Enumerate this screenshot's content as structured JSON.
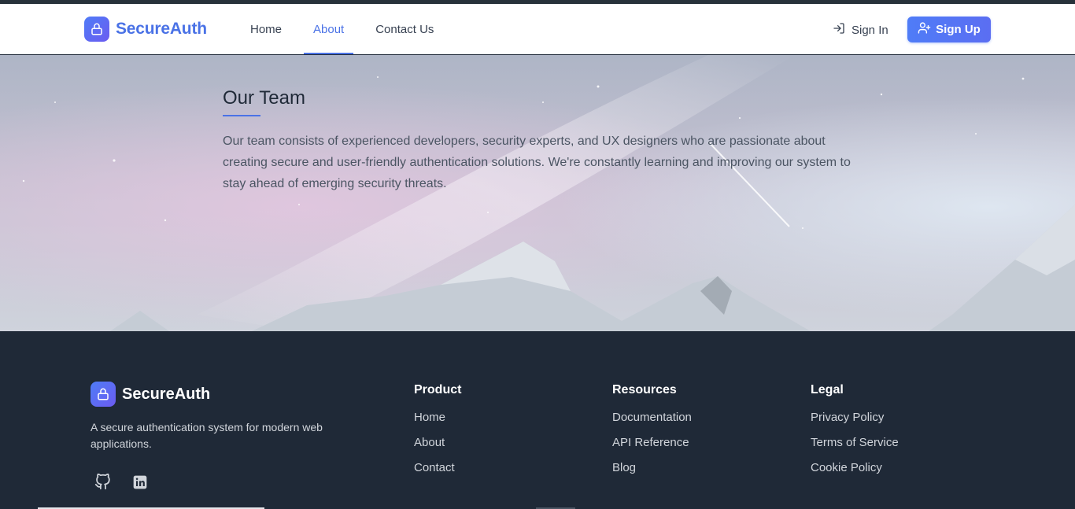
{
  "header": {
    "brand_name": "SecureAuth",
    "nav": [
      {
        "label": "Home",
        "active": false
      },
      {
        "label": "About",
        "active": true
      },
      {
        "label": "Contact Us",
        "active": false
      }
    ],
    "sign_in_label": "Sign In",
    "sign_up_label": "Sign Up"
  },
  "hero": {
    "title": "Our Team",
    "text": "Our team consists of experienced developers, security experts, and UX designers who are passionate about creating secure and user-friendly authentication solutions. We're constantly learning and improving our system to stay ahead of emerging security threats."
  },
  "footer": {
    "brand_name": "SecureAuth",
    "description": "A secure authentication system for modern web applications.",
    "socials": [
      {
        "icon": "github-icon"
      },
      {
        "icon": "linkedin-icon"
      }
    ],
    "columns": [
      {
        "title": "Product",
        "links": [
          "Home",
          "About",
          "Contact"
        ]
      },
      {
        "title": "Resources",
        "links": [
          "Documentation",
          "API Reference",
          "Blog"
        ]
      },
      {
        "title": "Legal",
        "links": [
          "Privacy Policy",
          "Terms of Service",
          "Cookie Policy"
        ]
      }
    ]
  },
  "colors": {
    "accent": "#4a72e6",
    "footer_bg": "#1f2937",
    "header_bg": "#ffffff"
  }
}
